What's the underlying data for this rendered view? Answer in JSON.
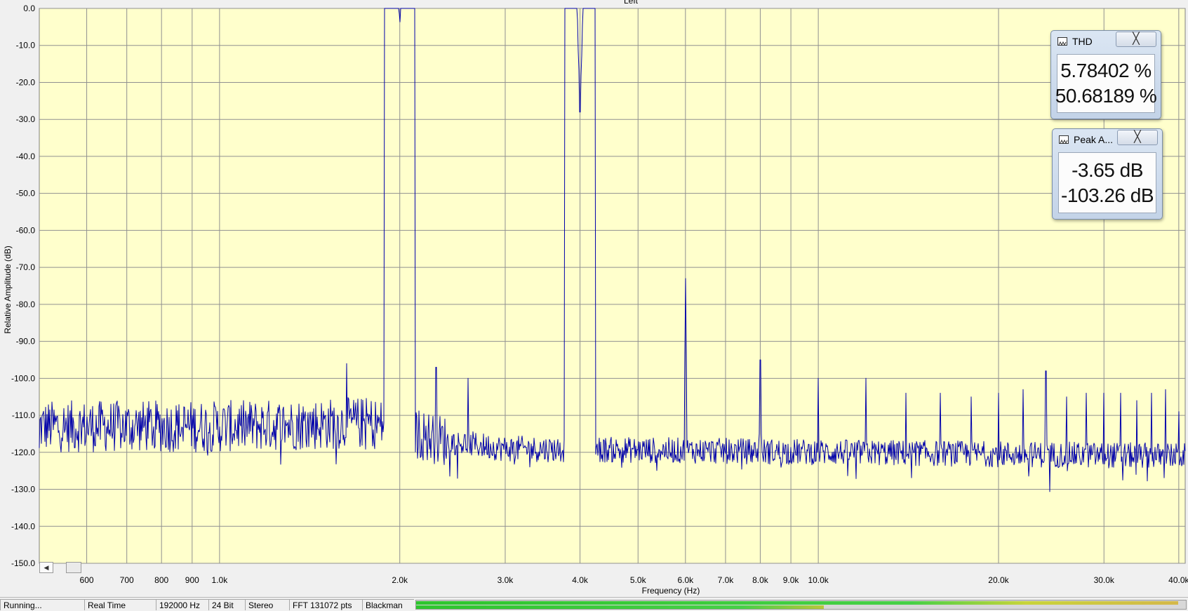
{
  "chart_data": {
    "type": "line",
    "title": "Left",
    "xlabel": "Frequency (Hz)",
    "ylabel": "Relative Amplitude (dB)",
    "x_scale": "log",
    "xlim": [
      500,
      41000
    ],
    "ylim": [
      -150,
      0
    ],
    "grid": true,
    "y_ticks": [
      0,
      -10,
      -20,
      -30,
      -40,
      -50,
      -60,
      -70,
      -80,
      -90,
      -100,
      -110,
      -120,
      -130,
      -140,
      -150
    ],
    "y_tick_labels": [
      "0.0",
      "-10.0",
      "-20.0",
      "-30.0",
      "-40.0",
      "-50.0",
      "-60.0",
      "-70.0",
      "-80.0",
      "-90.0",
      "-100.0",
      "-110.0",
      "-120.0",
      "-130.0",
      "-140.0",
      "-150.0"
    ],
    "x_ticks": [
      600,
      700,
      800,
      900,
      1000,
      2000,
      3000,
      4000,
      5000,
      6000,
      7000,
      8000,
      9000,
      10000,
      20000,
      30000,
      40000
    ],
    "x_tick_labels": [
      "600",
      "700",
      "800",
      "900",
      "1.0k",
      "2.0k",
      "3.0k",
      "4.0k",
      "5.0k",
      "6.0k",
      "7.0k",
      "8.0k",
      "9.0k",
      "10.0k",
      "20.0k",
      "30.0k",
      "40.0k"
    ],
    "series": [
      {
        "color": "#0000aa",
        "noise_floor_db": [
          [
            500,
            -113
          ],
          [
            1000,
            -113
          ],
          [
            1800,
            -112
          ],
          [
            2400,
            -117
          ],
          [
            3000,
            -119
          ],
          [
            40000,
            -121
          ]
        ],
        "peaks": [
          {
            "x": 2000,
            "y": -3.65
          },
          {
            "x": 4000,
            "y": -28
          },
          {
            "x": 6000,
            "y": -73
          },
          {
            "x": 8000,
            "y": -95
          },
          {
            "x": 1630,
            "y": -96
          },
          {
            "x": 2300,
            "y": -97
          },
          {
            "x": 2600,
            "y": -100
          },
          {
            "x": 10000,
            "y": -100
          },
          {
            "x": 12000,
            "y": -100
          },
          {
            "x": 14000,
            "y": -104
          },
          {
            "x": 16000,
            "y": -104
          },
          {
            "x": 18000,
            "y": -105
          },
          {
            "x": 20000,
            "y": -104
          },
          {
            "x": 22000,
            "y": -103
          },
          {
            "x": 24000,
            "y": -98
          },
          {
            "x": 26000,
            "y": -105
          },
          {
            "x": 28000,
            "y": -104
          },
          {
            "x": 30000,
            "y": -104
          },
          {
            "x": 32000,
            "y": -104
          },
          {
            "x": 34000,
            "y": -106
          },
          {
            "x": 36000,
            "y": -104
          },
          {
            "x": 38000,
            "y": -103
          },
          {
            "x": 40000,
            "y": -109
          }
        ]
      }
    ]
  },
  "meters": {
    "thd": {
      "title": "THD",
      "close_glyph": "╳",
      "icon": "waveform-icon",
      "values": [
        "5.78402 %",
        "50.68189 %"
      ]
    },
    "peak": {
      "title": "Peak A...",
      "close_glyph": "╳",
      "icon": "waveform-icon",
      "values": [
        "-3.65 dB",
        "-103.26 dB"
      ]
    }
  },
  "scrollbar": {
    "left_arrow": "◀"
  },
  "status_bar": {
    "state": "Running...",
    "mode": "Real Time",
    "sample_rate": "192000 Hz",
    "bit_depth": "24 Bit",
    "channels": "Stereo",
    "fft_size": "FFT 131072 pts",
    "window": "Blackman",
    "level_meter": [
      0.99,
      0.53
    ]
  },
  "colors": {
    "plot_background": "#ffffcc",
    "grid": "#909090",
    "trace": "#0000aa"
  }
}
